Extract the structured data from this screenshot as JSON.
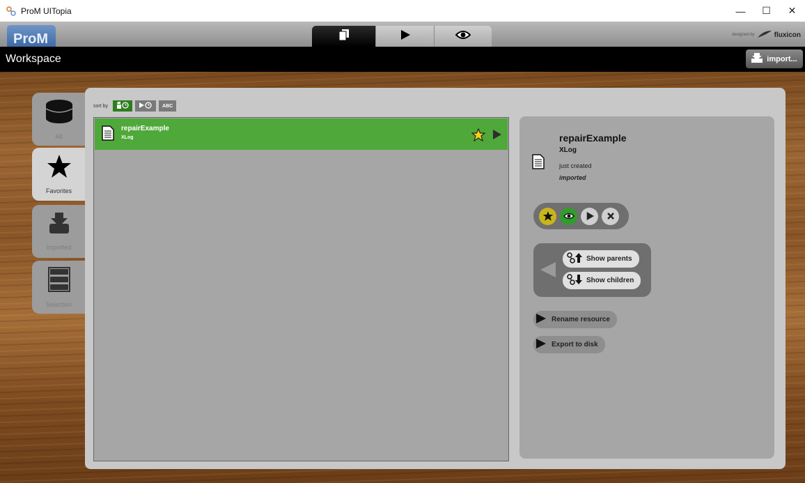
{
  "window": {
    "title": "ProM UITopia",
    "minimize": "—",
    "maximize": "☐",
    "close": "✕"
  },
  "header": {
    "logo": "ProM",
    "designed_by": "designed by",
    "designer": "fluxicon",
    "view_tabs": [
      "workspace-view",
      "actions-view",
      "visualize-view"
    ],
    "active_view": "workspace-view"
  },
  "workspace_bar": {
    "title": "Workspace",
    "import_label": "import..."
  },
  "categories": [
    {
      "label": "All",
      "icon": "database-icon",
      "active": false
    },
    {
      "label": "Favorites",
      "icon": "star-icon",
      "active": true
    },
    {
      "label": "Imported",
      "icon": "import-icon",
      "active": false
    },
    {
      "label": "Selection",
      "icon": "selection-icon",
      "active": false
    }
  ],
  "sort": {
    "label": "sort by",
    "options": [
      {
        "icon": "created-time-icon",
        "active": true
      },
      {
        "icon": "used-time-icon",
        "active": false
      },
      {
        "label": "ABC",
        "active": false
      }
    ]
  },
  "resources": [
    {
      "name": "repairExample",
      "type": "XLog",
      "favorite": true,
      "selected": true
    }
  ],
  "details": {
    "name": "repairExample",
    "type": "XLog",
    "created": "just created",
    "status": "imported",
    "show_parents": "Show parents",
    "show_children": "Show children",
    "rename": "Rename resource",
    "export": "Export to disk"
  },
  "colors": {
    "selected_item": "#4fa83a",
    "favorite_star": "#f5d21a",
    "panel": "#c8c8c8",
    "list_bg": "#a6a6a6"
  }
}
